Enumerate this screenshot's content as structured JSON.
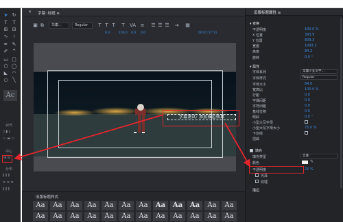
{
  "editor": {
    "tab_title": "字幕: 标题 ≡",
    "font_value": "华康...",
    "style_value": "Regular",
    "numbers": [
      "100.0",
      "0.0",
      "0.0",
      "0.0"
    ],
    "timecode": "00:02:57:11",
    "subtitle_text": "字幕测试: 添加描边效果",
    "style_swatch_label": "Aa",
    "styles_title": "旧版标题样式"
  },
  "tools_panel": {
    "section_a": "对齐",
    "section_b": "中心",
    "section_c": "分布"
  },
  "panel": {
    "title": "旧版标题属性 ≡",
    "transform_section": "变换",
    "transform": [
      {
        "label": "不透明度",
        "value": "100.0 %"
      },
      {
        "label": "X 位置",
        "value": "393.9"
      },
      {
        "label": "Y 位置",
        "value": "809.3"
      },
      {
        "label": "宽度",
        "value": "1093.1"
      },
      {
        "label": "高度",
        "value": "84.2"
      },
      {
        "label": "旋转",
        "value": "0.0 °"
      }
    ],
    "props_section": "属性",
    "props": [
      {
        "label": "字体系列",
        "dd": "华康少女文字..."
      },
      {
        "label": "字体样式",
        "dd": "Regular"
      },
      {
        "label": "字体大小",
        "value": "84.0"
      },
      {
        "label": "宽高比",
        "value": "100.0 %"
      },
      {
        "label": "行距",
        "value": "0.0"
      },
      {
        "label": "字偶间距",
        "value": "0.0"
      },
      {
        "label": "字符间距",
        "value": "0.0"
      },
      {
        "label": "基线位移",
        "value": "0.0"
      },
      {
        "label": "倾斜",
        "value": "0.0 °"
      },
      {
        "label": "小型大写字母",
        "value": ""
      },
      {
        "label": "小型大写字母大小",
        "value": "75.0 %"
      },
      {
        "label": "下划线",
        "value": ""
      },
      {
        "label": "扭曲",
        "value": ""
      }
    ],
    "fill_label": "填充",
    "fill_type_label": "填充类型",
    "fill_type_value": "实底",
    "color_label": "颜色",
    "opacity_label": "不透明度",
    "opacity_value": "25 %",
    "sheen_label": "光泽",
    "texture_label": "纹理",
    "stroke_label": "描边"
  }
}
